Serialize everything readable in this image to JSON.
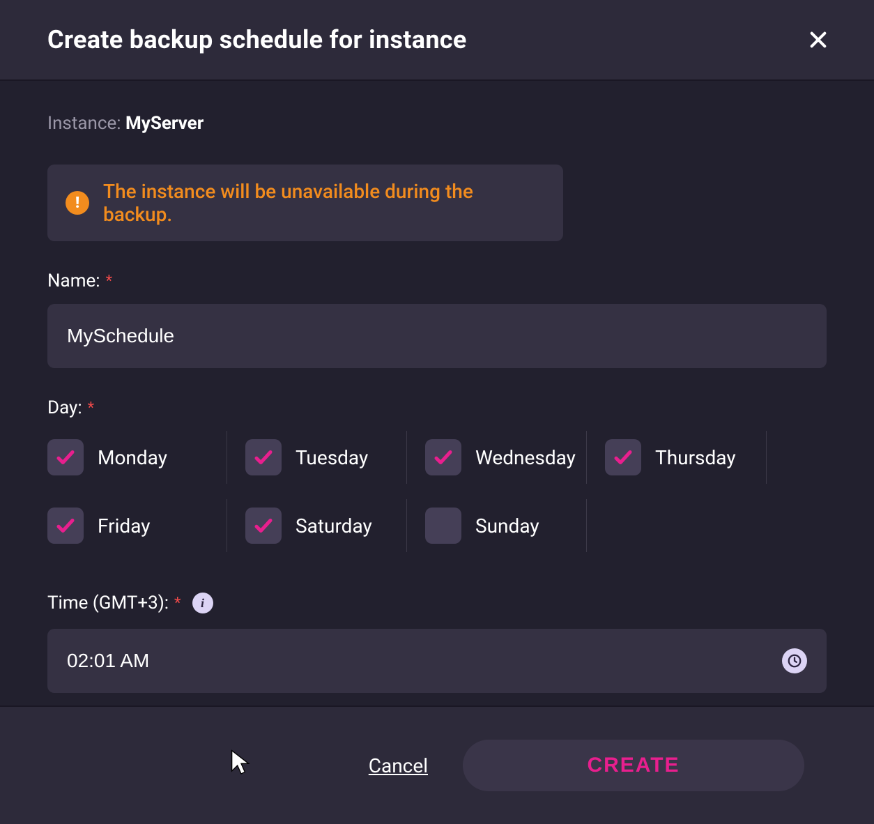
{
  "header": {
    "title": "Create backup schedule for instance"
  },
  "instance": {
    "label": "Instance: ",
    "name": "MyServer"
  },
  "alert": {
    "text": "The instance will be unavailable during the backup."
  },
  "form": {
    "name_label": "Name:",
    "name_value": "MySchedule",
    "day_label": "Day:",
    "days": [
      {
        "label": "Monday",
        "checked": true
      },
      {
        "label": "Tuesday",
        "checked": true
      },
      {
        "label": "Wednesday",
        "checked": true
      },
      {
        "label": "Thursday",
        "checked": true
      },
      {
        "label": "Friday",
        "checked": true
      },
      {
        "label": "Saturday",
        "checked": true
      },
      {
        "label": "Sunday",
        "checked": false
      }
    ],
    "time_label": "Time (GMT+3):",
    "time_value": "02:01 AM"
  },
  "footer": {
    "cancel": "Cancel",
    "create": "CREATE"
  },
  "colors": {
    "accent": "#e81f8e",
    "warning": "#f28c1e",
    "bg_panel": "#353143"
  }
}
